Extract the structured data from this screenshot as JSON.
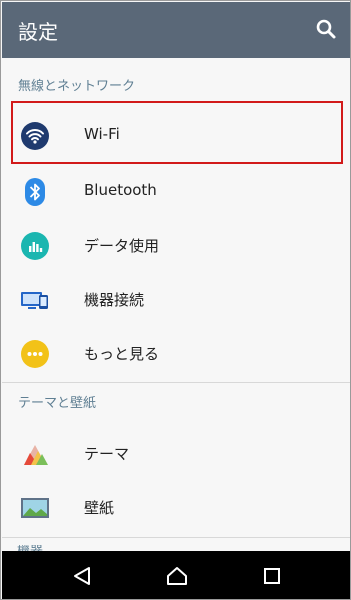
{
  "header": {
    "title": "設定"
  },
  "sections": {
    "wireless": "無線とネットワーク",
    "theme": "テーマと壁紙",
    "device_cut": "機器"
  },
  "items": {
    "wifi": "Wi-Fi",
    "bluetooth": "Bluetooth",
    "data_usage": "データ使用",
    "device_connection": "機器接続",
    "more": "もっと見る",
    "theme": "テーマ",
    "wallpaper": "壁紙"
  },
  "colors": {
    "appbar": "#5a6878",
    "section_text": "#5f7f93",
    "wifi_icon": "#1f3a6e",
    "bluetooth_icon": "#2d8ae6",
    "data_usage_icon": "#1bb6b0",
    "more_icon": "#f2c218",
    "highlight": "#d21a1a"
  },
  "icons": {
    "search": "search-icon",
    "wifi": "wifi-icon",
    "bluetooth": "bluetooth-icon",
    "data_usage": "data-usage-icon",
    "device_connection": "device-connection-icon",
    "more": "more-icon",
    "theme": "theme-icon",
    "wallpaper": "wallpaper-icon",
    "back": "back-icon",
    "home": "home-icon",
    "recents": "recents-icon"
  }
}
